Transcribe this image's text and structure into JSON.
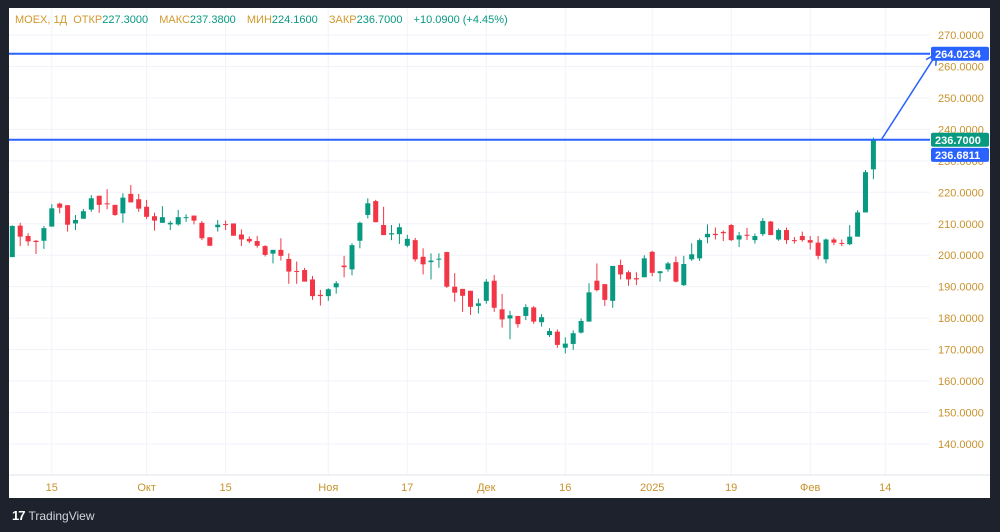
{
  "legend": {
    "symbol": "MOEX, 1Д",
    "open_label": "ОТКР",
    "open": "227.3000",
    "high_label": "МАКС",
    "high": "237.3800",
    "low_label": "МИН",
    "low": "224.1600",
    "close_label": "ЗАКР",
    "close": "236.7000",
    "change": "+10.0900 (+4.45%)"
  },
  "footer": {
    "brand": "TradingView"
  },
  "colors": {
    "up": "#089981",
    "down": "#f23645",
    "line": "#2962ff",
    "axis_text": "#c8922c",
    "grid": "#f0f3fa"
  },
  "chart_data": {
    "type": "candlestick",
    "symbol": "MOEX",
    "interval": "1Д",
    "ylim": [
      130,
      276
    ],
    "y_ticks": [
      "140.0000",
      "150.0000",
      "160.0000",
      "170.0000",
      "180.0000",
      "190.0000",
      "200.0000",
      "210.0000",
      "220.0000",
      "230.0000",
      "240.0000",
      "250.0000",
      "260.0000",
      "270.0000"
    ],
    "x_ticks": [
      {
        "label": "15",
        "index": 5
      },
      {
        "label": "Окт",
        "index": 17
      },
      {
        "label": "15",
        "index": 27
      },
      {
        "label": "Ноя",
        "index": 40
      },
      {
        "label": "17",
        "index": 50
      },
      {
        "label": "Дек",
        "index": 60
      },
      {
        "label": "16",
        "index": 70
      },
      {
        "label": "2025",
        "index": 81
      },
      {
        "label": "19",
        "index": 91
      },
      {
        "label": "Фев",
        "index": 101
      },
      {
        "label": "14",
        "index": 110.5
      }
    ],
    "candles_ohlc": [
      [
        199.4,
        209.5,
        199.4,
        209.3
      ],
      [
        209.4,
        210.3,
        202.9,
        205.9
      ],
      [
        206.1,
        207,
        203,
        204.4
      ],
      [
        204.6,
        204.8,
        200.4,
        204.2
      ],
      [
        204.6,
        209.3,
        202,
        208.6
      ],
      [
        209.1,
        216.2,
        209.1,
        214.9
      ],
      [
        216.4,
        216.7,
        213.3,
        215.1
      ],
      [
        215.9,
        215.9,
        207.5,
        209.7
      ],
      [
        210.1,
        212.8,
        208,
        211.2
      ],
      [
        211.6,
        214.7,
        211.6,
        214
      ],
      [
        214.5,
        219.1,
        213.8,
        218.1
      ],
      [
        218.9,
        218.9,
        213.5,
        216
      ],
      [
        216.5,
        221,
        214.6,
        216.2
      ],
      [
        216,
        216,
        212.5,
        212.8
      ],
      [
        213.3,
        219.7,
        210.3,
        218.3
      ],
      [
        219.5,
        222.3,
        216.8,
        216.8
      ],
      [
        217.8,
        219.5,
        213.8,
        214.8
      ],
      [
        215.4,
        217.6,
        211.5,
        212.2
      ],
      [
        212.4,
        213.5,
        207.8,
        211
      ],
      [
        210.3,
        215.6,
        210.3,
        212.1
      ],
      [
        209.8,
        210.9,
        208,
        210.3
      ],
      [
        209.8,
        214.4,
        209.4,
        212.1
      ],
      [
        211.8,
        213,
        210.6,
        212.1
      ],
      [
        212.6,
        212.6,
        209.8,
        211
      ],
      [
        210.3,
        210.9,
        204.8,
        205.4
      ],
      [
        205.7,
        205.7,
        203,
        203
      ],
      [
        208.9,
        211.2,
        207.5,
        209.7
      ],
      [
        209.9,
        211,
        208,
        209.6
      ],
      [
        210.1,
        210.1,
        206.2,
        206.2
      ],
      [
        206.6,
        208.2,
        202.9,
        205
      ],
      [
        205.2,
        206,
        203.8,
        204.4
      ],
      [
        204.5,
        206.1,
        202.4,
        203
      ],
      [
        202.9,
        203.2,
        199.6,
        200.1
      ],
      [
        200.5,
        201.7,
        197.4,
        201.7
      ],
      [
        201.7,
        205.4,
        198.3,
        199.8
      ],
      [
        198.8,
        200.6,
        190.9,
        194.8
      ],
      [
        195,
        198,
        190.9,
        194.8
      ],
      [
        195.3,
        196,
        192.5,
        191.6
      ],
      [
        192.3,
        193.4,
        185.8,
        187
      ],
      [
        187.4,
        189,
        184,
        187
      ],
      [
        187,
        189.5,
        185.5,
        189.2
      ],
      [
        189.8,
        191.8,
        187.8,
        191.1
      ],
      [
        196.7,
        199.8,
        193,
        196.2
      ],
      [
        195.5,
        203.8,
        193.6,
        203.2
      ],
      [
        204.6,
        210.7,
        202.2,
        210.3
      ],
      [
        212.8,
        218.1,
        211.7,
        216.5
      ],
      [
        217.2,
        217.6,
        210.5,
        210.5
      ],
      [
        209.6,
        215.4,
        206.4,
        206.4
      ],
      [
        206.6,
        209.6,
        204.8,
        207
      ],
      [
        206.7,
        210.1,
        203.6,
        208.9
      ],
      [
        203,
        206.5,
        202.5,
        205.2
      ],
      [
        204.8,
        205.5,
        198,
        198.7
      ],
      [
        199.5,
        202.2,
        193.9,
        197.1
      ],
      [
        197.8,
        200.6,
        192.3,
        198.3
      ],
      [
        198.7,
        200.6,
        196,
        198.9
      ],
      [
        201,
        201.1,
        189.6,
        190
      ],
      [
        190,
        194.3,
        185.2,
        188.1
      ],
      [
        189.3,
        189.3,
        182,
        187.1
      ],
      [
        188.7,
        188.7,
        181,
        183.6
      ],
      [
        183.9,
        186.2,
        181.5,
        184.7
      ],
      [
        185.5,
        192.4,
        184.6,
        191.6
      ],
      [
        191.9,
        193.7,
        182,
        183.3
      ],
      [
        182.8,
        187.7,
        177,
        179.6
      ],
      [
        179.9,
        182.3,
        173.3,
        180.9
      ],
      [
        180.7,
        180.7,
        177,
        178.1
      ],
      [
        180.7,
        184.4,
        179.4,
        183.5
      ],
      [
        183.4,
        183.8,
        178.2,
        178.9
      ],
      [
        178.7,
        181.3,
        177.3,
        180.3
      ],
      [
        174.6,
        176.8,
        174,
        175.9
      ],
      [
        175.7,
        176.4,
        170.6,
        171.5
      ],
      [
        170.6,
        173.9,
        168.8,
        171.9
      ],
      [
        171.8,
        176.1,
        169.9,
        175.2
      ],
      [
        175.4,
        179.9,
        175.1,
        179.1
      ],
      [
        178.9,
        191.1,
        178.9,
        188.2
      ],
      [
        191.9,
        197.4,
        188.5,
        188.9
      ],
      [
        190.8,
        190.8,
        183.9,
        185.8
      ],
      [
        185.5,
        196.6,
        183.3,
        196.6
      ],
      [
        196.9,
        198.6,
        192.3,
        193.9
      ],
      [
        194.6,
        195.1,
        190.3,
        192.3
      ],
      [
        192.7,
        194.6,
        190.5,
        192.3
      ],
      [
        193,
        200,
        193,
        199
      ],
      [
        201.1,
        201.4,
        193.3,
        194.4
      ],
      [
        194.3,
        195,
        191.6,
        194.9
      ],
      [
        195.5,
        197.9,
        194.8,
        197.4
      ],
      [
        197.8,
        199.6,
        191.4,
        191.6
      ],
      [
        190.5,
        199.8,
        190.2,
        197.2
      ],
      [
        198.7,
        203.8,
        198.2,
        200.3
      ],
      [
        199,
        205.3,
        198.2,
        204.8
      ],
      [
        205.7,
        209.8,
        203.8,
        206.8
      ],
      [
        206.8,
        208.8,
        205,
        206.4
      ],
      [
        207.4,
        207.9,
        204.5,
        207
      ],
      [
        209.6,
        209.9,
        204.5,
        204.8
      ],
      [
        205,
        207.4,
        202.6,
        206.3
      ],
      [
        206.5,
        208.7,
        204.8,
        206.3
      ],
      [
        204.8,
        206.9,
        203.7,
        206.1
      ],
      [
        206.7,
        211.8,
        206.1,
        210.9
      ],
      [
        210.7,
        210.9,
        206.4,
        206.4
      ],
      [
        205,
        208.5,
        204.6,
        208
      ],
      [
        208,
        208.8,
        203.6,
        204.8
      ],
      [
        204.8,
        205.8,
        203.7,
        204.5
      ],
      [
        206.1,
        207.5,
        204.3,
        204.8
      ],
      [
        204.8,
        206.1,
        201.8,
        204
      ],
      [
        204,
        206.1,
        198.7,
        199.8
      ],
      [
        198.7,
        205.3,
        197.4,
        205
      ],
      [
        205,
        205.6,
        203.2,
        204
      ],
      [
        203.9,
        205,
        202.9,
        203.6
      ],
      [
        203.5,
        209.6,
        203.2,
        205.9
      ],
      [
        205.9,
        214.3,
        205.9,
        213.6
      ],
      [
        213.6,
        227.1,
        213.6,
        226.4
      ],
      [
        227.3,
        237.38,
        224.16,
        236.7
      ]
    ],
    "horizontal_lines": [
      {
        "price": 264.0234,
        "label": "264.0234",
        "color": "#2962ff"
      },
      {
        "price": 236.7,
        "label": "236.7000",
        "color": "#2962ff"
      }
    ],
    "price_labels": [
      {
        "price": 236.7,
        "label": "236.7000",
        "color": "#089981"
      },
      {
        "price": 236.6811,
        "label": "236.6811",
        "color": "#2962ff"
      }
    ],
    "projection_arrow": {
      "from_index": 110,
      "from_price": 236.7,
      "to_index": 117,
      "to_price": 264.0234
    }
  }
}
